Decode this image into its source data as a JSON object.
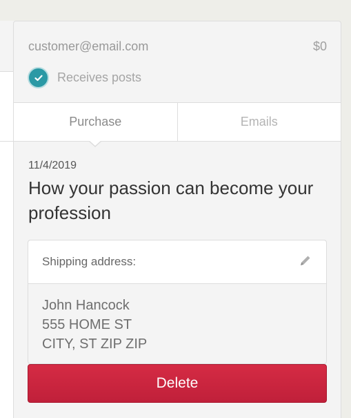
{
  "customer": {
    "email": "customer@email.com",
    "amount": "$0",
    "receives_posts_label": "Receives posts",
    "receives_posts_checked": true
  },
  "tabs": [
    {
      "label": "Purchase",
      "active": true
    },
    {
      "label": "Emails",
      "active": false
    }
  ],
  "purchase": {
    "date": "11/4/2019",
    "title": "How your passion can become your profession"
  },
  "shipping": {
    "heading": "Shipping address:",
    "lines": [
      "John Hancock",
      "555 HOME ST",
      "CITY, ST ZIP ZIP"
    ]
  },
  "actions": {
    "delete_label": "Delete"
  },
  "colors": {
    "accent_teal": "#2b99a5",
    "delete_red": "#c8253e"
  },
  "icons": {
    "check": "checkmark-icon",
    "edit": "pencil-icon"
  }
}
